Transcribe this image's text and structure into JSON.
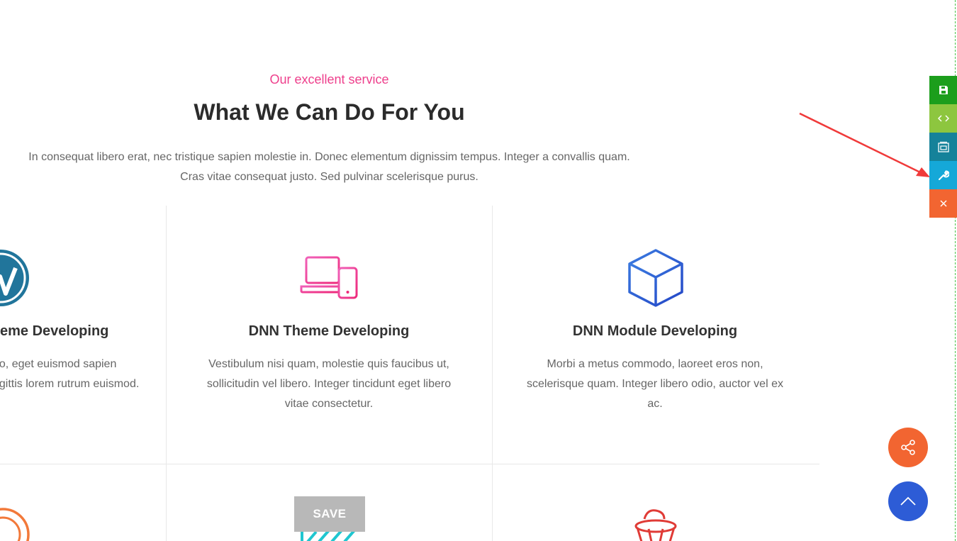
{
  "section": {
    "subtitle": "Our excellent service",
    "title": "What We Can Do For You",
    "intro": "In consequat libero erat, nec tristique sapien molestie in. Donec elementum dignissim tempus. Integer a convallis quam. Cras vitae consequat justo. Sed pulvinar scelerisque purus."
  },
  "cards": [
    {
      "title": "eme Developing",
      "text": "eo, eget euismod sapien agittis lorem rutrum euismod.",
      "icon": "wordpress-icon"
    },
    {
      "title": "DNN Theme Developing",
      "text": "Vestibulum nisi quam, molestie quis faucibus ut, sollicitudin vel libero. Integer tincidunt eget libero vitae consectetur.",
      "icon": "devices-icon"
    },
    {
      "title": "DNN Module Developing",
      "text": "Morbi a metus commodo, laoreet eros non, scelerisque quam. Integer libero odio, auctor vel ex ac.",
      "icon": "cube-icon"
    }
  ],
  "save_button": {
    "label": "SAVE"
  },
  "colors": {
    "accent_pink": "#ee3f8c",
    "save_green": "#1c9e1c",
    "code_green": "#8dc63f",
    "teal": "#15829a",
    "cyan": "#15a8d8",
    "orange": "#f26531",
    "blue": "#2d5cd6"
  }
}
